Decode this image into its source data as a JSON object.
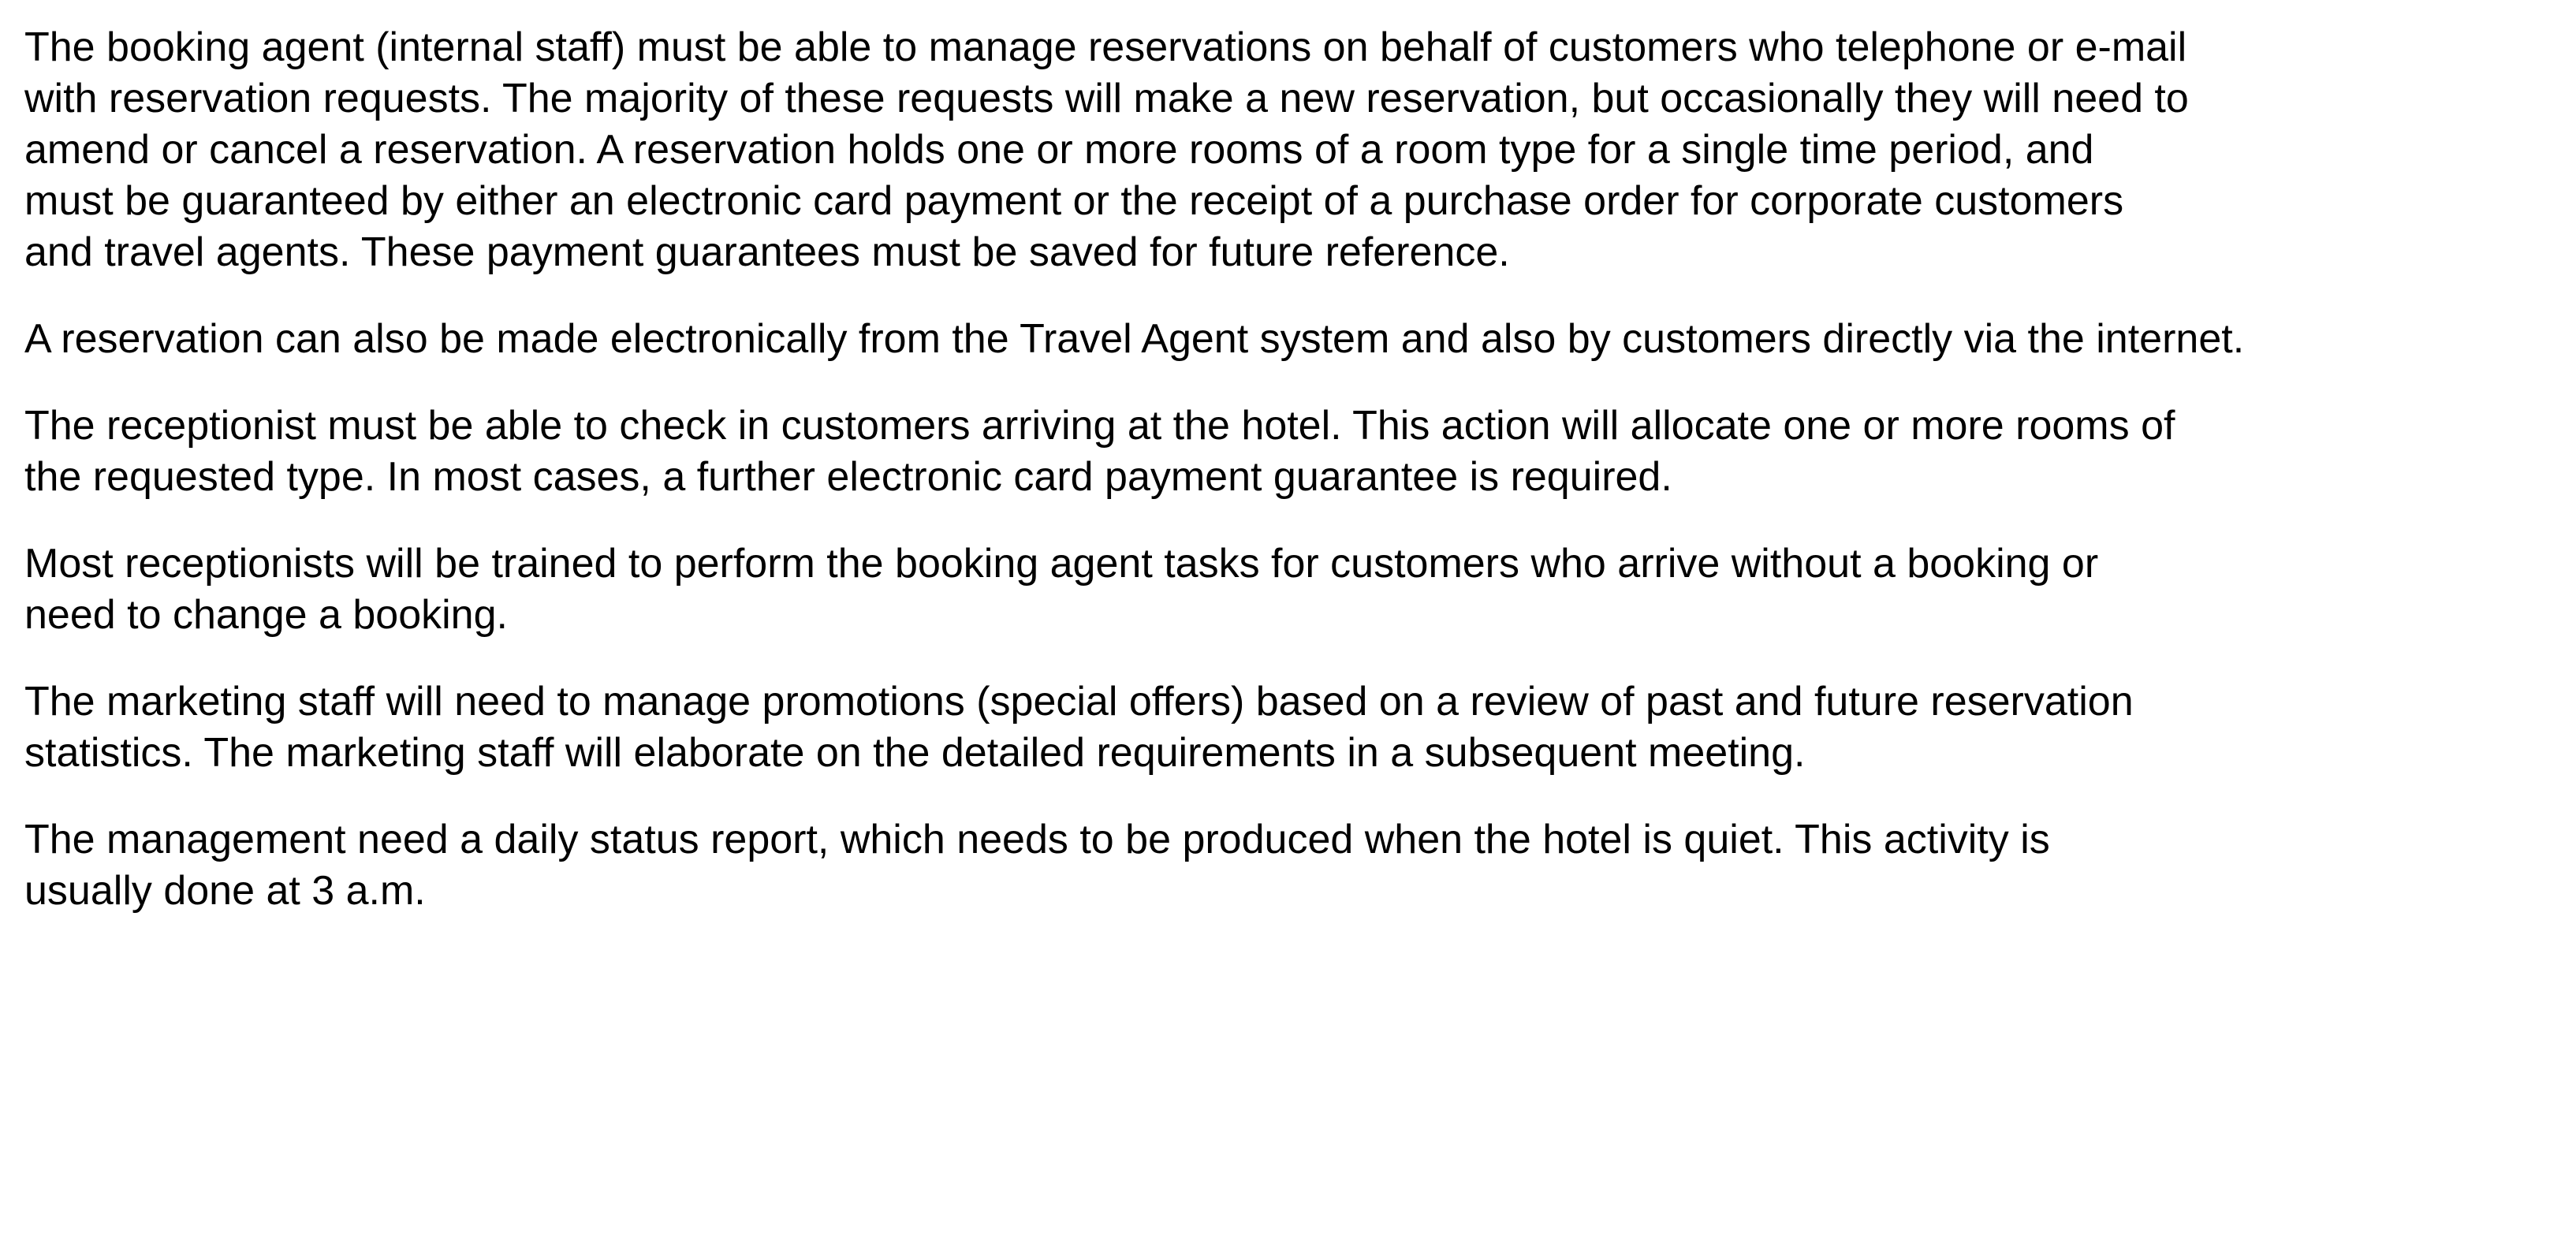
{
  "document": {
    "paragraphs": [
      {
        "lines": [
          "The booking agent (internal staff) must be able to manage reservations on behalf of customers who telephone or e-mail",
          "with reservation requests. The majority of these requests will make a new reservation, but occasionally they will need to",
          "amend or cancel a reservation. A reservation holds one or more rooms of a room type for a single time period, and",
          "must be guaranteed by either an electronic card payment or the receipt of a purchase order for corporate customers",
          "and travel agents. These payment guarantees must be saved for future reference."
        ]
      },
      {
        "lines": [
          "A reservation can also be made electronically from the Travel Agent system and also by customers directly via the internet."
        ]
      },
      {
        "lines": [
          "The receptionist must be able to check in customers arriving at the hotel. This action will allocate one or more rooms of",
          "the requested type. In most cases, a further electronic card payment guarantee is required."
        ]
      },
      {
        "lines": [
          "Most receptionists will be trained to perform the booking agent tasks for customers who arrive without a booking or",
          "need to change a booking."
        ]
      },
      {
        "lines": [
          "The marketing staff will need to manage promotions (special offers) based on a review of past and future reservation",
          "statistics. The marketing staff will elaborate on the detailed requirements in a subsequent meeting."
        ]
      },
      {
        "lines": [
          "The management need a daily status report, which needs to be produced when the hotel is quiet. This activity is",
          "usually done at 3 a.m."
        ]
      }
    ]
  }
}
